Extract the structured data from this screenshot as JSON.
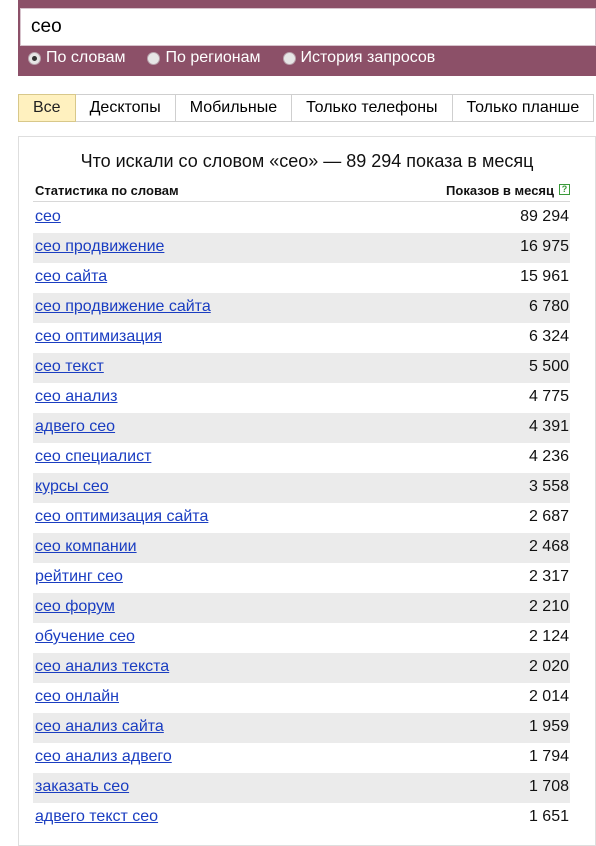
{
  "search": {
    "query": "сео"
  },
  "modes": [
    {
      "label": "По словам",
      "checked": true
    },
    {
      "label": "По регионам",
      "checked": false
    },
    {
      "label": "История запросов",
      "checked": false
    }
  ],
  "tabs": [
    "Все",
    "Десктопы",
    "Мобильные",
    "Только телефоны",
    "Только планше"
  ],
  "table": {
    "title": "Что искали со словом «сео» — 89 294 показа в месяц",
    "col_left": "Статистика по словам",
    "col_right": "Показов в месяц",
    "help_glyph": "?",
    "rows": [
      {
        "phrase": "сео",
        "count": "89 294"
      },
      {
        "phrase": "сео продвижение",
        "count": "16 975"
      },
      {
        "phrase": "сео сайта",
        "count": "15 961"
      },
      {
        "phrase": "сео продвижение сайта",
        "count": "6 780"
      },
      {
        "phrase": "сео оптимизация",
        "count": "6 324"
      },
      {
        "phrase": "сео текст",
        "count": "5 500"
      },
      {
        "phrase": "сео анализ",
        "count": "4 775"
      },
      {
        "phrase": "адвего сео",
        "count": "4 391"
      },
      {
        "phrase": "сео специалист",
        "count": "4 236"
      },
      {
        "phrase": "курсы сео",
        "count": "3 558"
      },
      {
        "phrase": "сео оптимизация сайта",
        "count": "2 687"
      },
      {
        "phrase": "сео компании",
        "count": "2 468"
      },
      {
        "phrase": "рейтинг сео",
        "count": "2 317"
      },
      {
        "phrase": "сео форум",
        "count": "2 210"
      },
      {
        "phrase": "обучение сео",
        "count": "2 124"
      },
      {
        "phrase": "сео анализ текста",
        "count": "2 020"
      },
      {
        "phrase": "сео онлайн",
        "count": "2 014"
      },
      {
        "phrase": "сео анализ сайта",
        "count": "1 959"
      },
      {
        "phrase": "сео анализ адвего",
        "count": "1 794"
      },
      {
        "phrase": "заказать сео",
        "count": "1 708"
      },
      {
        "phrase": "адвего текст сео",
        "count": "1 651"
      }
    ]
  }
}
